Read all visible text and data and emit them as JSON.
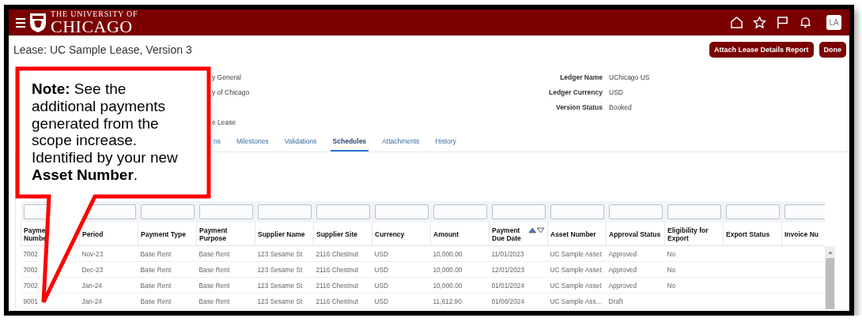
{
  "header": {
    "university_line": "THE UNIVERSITY OF",
    "university_name": "CHICAGO",
    "avatar": "LA"
  },
  "page": {
    "title": "Lease: UC Sample Lease, Version 3",
    "buttons": [
      "Attach Lease Details Report",
      "Done"
    ]
  },
  "details": [
    {
      "left": "y General",
      "label": "Ledger Name",
      "value": "UChicago US"
    },
    {
      "left": "y of Chicago",
      "label": "Ledger Currency",
      "value": "USD"
    },
    {
      "label": "Version Status",
      "value": "Booked"
    },
    {
      "left": "e Lease"
    }
  ],
  "tabs": [
    {
      "label": "ns",
      "selected": false
    },
    {
      "label": "Milestones",
      "selected": false
    },
    {
      "label": "Validations",
      "selected": false
    },
    {
      "label": "Schedules",
      "selected": true
    },
    {
      "label": "Attachments",
      "selected": false
    },
    {
      "label": "History",
      "selected": false
    }
  ],
  "table": {
    "columns": [
      {
        "lines": [
          "Payme",
          "Numbe"
        ]
      },
      {
        "lines": [
          "Period"
        ]
      },
      {
        "lines": [
          "Payment Type"
        ]
      },
      {
        "lines": [
          "Payment",
          "Purpose"
        ]
      },
      {
        "lines": [
          "Supplier Name"
        ]
      },
      {
        "lines": [
          "Supplier Site"
        ]
      },
      {
        "lines": [
          "Currency"
        ]
      },
      {
        "lines": [
          "Amount"
        ]
      },
      {
        "lines": [
          "Payment",
          "Due Date"
        ],
        "sort_ascending": true
      },
      {
        "lines": [
          "Asset Number"
        ]
      },
      {
        "lines": [
          "Approval Status"
        ]
      },
      {
        "lines": [
          "Eligibility for",
          "Export"
        ]
      },
      {
        "lines": [
          "Export Status"
        ]
      },
      {
        "lines": [
          "Invoice Nu"
        ]
      }
    ],
    "rows": [
      [
        "7002",
        "Nov-23",
        "Base Rent",
        "Base Rent",
        "123 Sesame St",
        "2116 Chestnut",
        "USD",
        "10,000.00",
        "11/01/2023",
        "UC Sample Asset",
        "Approved",
        "No"
      ],
      [
        "7002",
        "Dec-23",
        "Base Rent",
        "Base Rent",
        "123 Sesame St",
        "2116 Chestnut",
        "USD",
        "10,000.00",
        "12/01/2023",
        "UC Sample Asset",
        "Approved",
        "No"
      ],
      [
        "7002",
        "Jan-24",
        "Base Rent",
        "Base Rent",
        "123 Sesame St",
        "2116 Chestnut",
        "USD",
        "10,000.00",
        "01/01/2024",
        "UC Sample Asset",
        "Approved",
        "No"
      ],
      [
        "9001",
        "Jan-24",
        "Base Rent",
        "Base Rent",
        "123 Sesame St",
        "2116 Chestnut",
        "USD",
        "11,612.90",
        "01/08/2024",
        "UC Sample Ass…",
        "Draft"
      ]
    ]
  },
  "callout": {
    "text": "**Note:** See the additional payments generated from the scope increase. Identified by your new **Asset Number**."
  }
}
